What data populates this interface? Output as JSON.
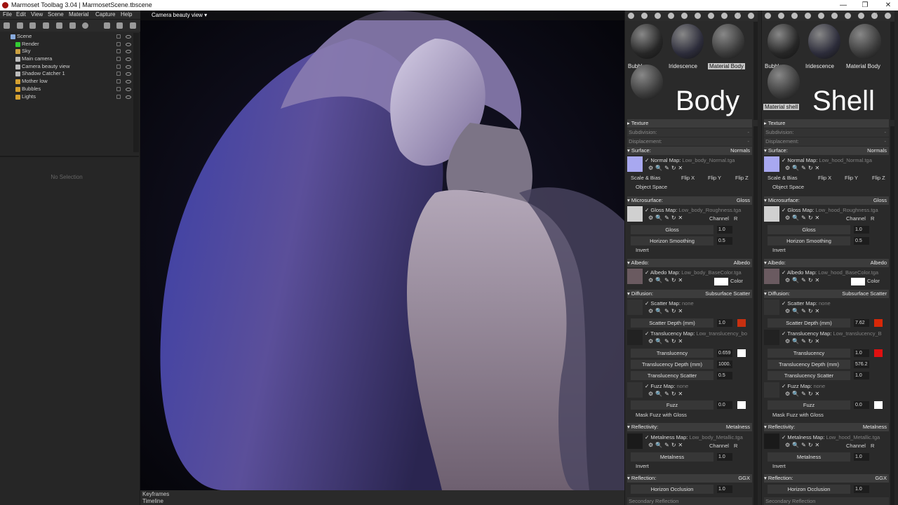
{
  "window": {
    "title": "Marmoset Toolbag 3.04  |  MarmosetScene.tbscene",
    "controls": [
      "—",
      "❐",
      "✕"
    ]
  },
  "menu": [
    "File",
    "Edit",
    "View",
    "Scene",
    "Material",
    "Capture",
    "Help"
  ],
  "scene_tree": [
    {
      "label": "Scene",
      "icon": "scene-icon",
      "color": "#8ad",
      "indent": 0
    },
    {
      "label": "Render",
      "icon": "render-icon",
      "color": "#3c3",
      "indent": 1
    },
    {
      "label": "Sky",
      "icon": "sky-icon",
      "color": "#caa040",
      "indent": 1
    },
    {
      "label": "Main camera",
      "icon": "camera-icon",
      "color": "#bbb",
      "indent": 1
    },
    {
      "label": "Camera beauty view",
      "icon": "camera-icon",
      "color": "#bbb",
      "indent": 1
    },
    {
      "label": "Shadow Catcher 1",
      "icon": "shadow-catcher-icon",
      "color": "#bbb",
      "indent": 1
    },
    {
      "label": "Mother low",
      "icon": "folder-icon",
      "color": "#d4a030",
      "indent": 1
    },
    {
      "label": "Bubbles",
      "icon": "folder-icon",
      "color": "#d4a030",
      "indent": 1
    },
    {
      "label": "Lights",
      "icon": "folder-icon",
      "color": "#d4a030",
      "indent": 1
    }
  ],
  "no_selection": "No Selection",
  "viewport": {
    "camera": "Camera beauty view ▾"
  },
  "timeline": {
    "keyframes": "Keyframes",
    "timeline": "Timeline"
  },
  "panels": [
    {
      "materials": [
        {
          "name": "Bubbles",
          "selected": false,
          "color": "#262626"
        },
        {
          "name": "Iridescence",
          "selected": false,
          "color": "#2c2c3a"
        },
        {
          "name": "Material Body",
          "selected": true,
          "color": "#3a3a3a"
        },
        {
          "name": "",
          "selected": false,
          "color": "#3b3b3b"
        }
      ],
      "big_label": "Body",
      "texture": "Texture",
      "subdivision": "Subdivision:",
      "displacement": "Displacement:",
      "dash": "-",
      "surface": {
        "title": "Surface:",
        "mode": "Normals",
        "map_label": "Normal Map:",
        "map_file": "Low_body_Normal.tga",
        "scale_bias": "Scale & Bias",
        "flip_x": "Flip X",
        "flip_y": "Flip Y",
        "flip_z": "Flip Z",
        "object_space": "Object Space"
      },
      "micro": {
        "title": "Microsurface:",
        "mode": "Gloss",
        "map_label": "Gloss Map:",
        "map_file": "Low_body_Roughness.tga",
        "channel": "Channel",
        "channel_val": "R",
        "gloss": "Gloss",
        "gloss_val": "1.0",
        "horizon": "Horizon Smoothing",
        "horizon_val": "0.5",
        "invert": "Invert"
      },
      "albedo": {
        "title": "Albedo:",
        "mode": "Albedo",
        "map_label": "Albedo Map:",
        "map_file": "Low_body_BaseColor.tga",
        "color": "Color",
        "swatch": "#ffffff"
      },
      "diffusion": {
        "title": "Diffusion:",
        "mode": "Subsurface Scatter",
        "scatter_map": "Scatter Map:",
        "scatter_file": "none",
        "scatter_depth": "Scatter Depth (mm)",
        "scatter_depth_val": "1.0",
        "scatter_swatch": "#c83010",
        "trans_map": "Translucency Map:",
        "trans_file": "Low_translucency_bo",
        "translucency": "Translucency",
        "translucency_val": "0.659",
        "trans_swatch": "#ffffff",
        "trans_depth": "Translucency Depth (mm)",
        "trans_depth_val": "1000.",
        "trans_scatter": "Translucency Scatter",
        "trans_scatter_val": "0.5",
        "fuzz_map": "Fuzz Map:",
        "fuzz_file": "none",
        "fuzz": "Fuzz",
        "fuzz_val": "0.0",
        "fuzz_swatch": "#ffffff",
        "mask_fuzz": "Mask Fuzz with Gloss"
      },
      "reflectivity": {
        "title": "Reflectivity:",
        "mode": "Metalness",
        "map_label": "Metalness Map:",
        "map_file": "Low_body_Metallic.tga",
        "channel": "Channel",
        "channel_val": "R",
        "metalness": "Metalness",
        "metalness_val": "1.0",
        "invert": "Invert"
      },
      "reflection": {
        "title": "Reflection:",
        "mode": "GGX",
        "horizon": "Horizon Occlusion",
        "horizon_val": "1.0",
        "secondary": "Secondary Reflection"
      }
    },
    {
      "materials": [
        {
          "name": "Bubbles",
          "selected": false,
          "color": "#262626"
        },
        {
          "name": "Iridescence",
          "selected": false,
          "color": "#2c2c3a"
        },
        {
          "name": "Material Body",
          "selected": false,
          "color": "#3a3a3a"
        },
        {
          "name": "Material shell",
          "selected": true,
          "color": "#3b3b3b"
        }
      ],
      "big_label": "Shell",
      "texture": "Texture",
      "subdivision": "Subdivision:",
      "displacement": "Displacement:",
      "dash": "-",
      "surface": {
        "title": "Surface:",
        "mode": "Normals",
        "map_label": "Normal Map:",
        "map_file": "Low_hood_Normal.tga",
        "scale_bias": "Scale & Bias",
        "flip_x": "Flip X",
        "flip_y": "Flip Y",
        "flip_z": "Flip Z",
        "object_space": "Object Space"
      },
      "micro": {
        "title": "Microsurface:",
        "mode": "Gloss",
        "map_label": "Gloss Map:",
        "map_file": "Low_hood_Roughness.tga",
        "channel": "Channel",
        "channel_val": "R",
        "gloss": "Gloss",
        "gloss_val": "1.0",
        "horizon": "Horizon Smoothing",
        "horizon_val": "0.5",
        "invert": "Invert"
      },
      "albedo": {
        "title": "Albedo:",
        "mode": "Albedo",
        "map_label": "Albedo Map:",
        "map_file": "Low_hood_BaseColor.tga",
        "color": "Color",
        "swatch": "#ffffff"
      },
      "diffusion": {
        "title": "Diffusion:",
        "mode": "Subsurface Scatter",
        "scatter_map": "Scatter Map:",
        "scatter_file": "none",
        "scatter_depth": "Scatter Depth (mm)",
        "scatter_depth_val": "7.62",
        "scatter_swatch": "#d82808",
        "trans_map": "Translucency Map:",
        "trans_file": "Low_translucency_B",
        "translucency": "Translucency",
        "translucency_val": "1.0",
        "trans_swatch": "#e01010",
        "trans_depth": "Translucency Depth (mm)",
        "trans_depth_val": "576.2",
        "trans_scatter": "Translucency Scatter",
        "trans_scatter_val": "1.0",
        "fuzz_map": "Fuzz Map:",
        "fuzz_file": "none",
        "fuzz": "Fuzz",
        "fuzz_val": "0.0",
        "fuzz_swatch": "#ffffff",
        "mask_fuzz": "Mask Fuzz with Gloss"
      },
      "reflectivity": {
        "title": "Reflectivity:",
        "mode": "Metalness",
        "map_label": "Metalness Map:",
        "map_file": "Low_hood_Metallic.tga",
        "channel": "Channel",
        "channel_val": "R",
        "metalness": "Metalness",
        "metalness_val": "1.0",
        "invert": "Invert"
      },
      "reflection": {
        "title": "Reflection:",
        "mode": "GGX",
        "horizon": "Horizon Occlusion",
        "horizon_val": "1.0",
        "secondary": "Secondary Reflection"
      }
    }
  ]
}
